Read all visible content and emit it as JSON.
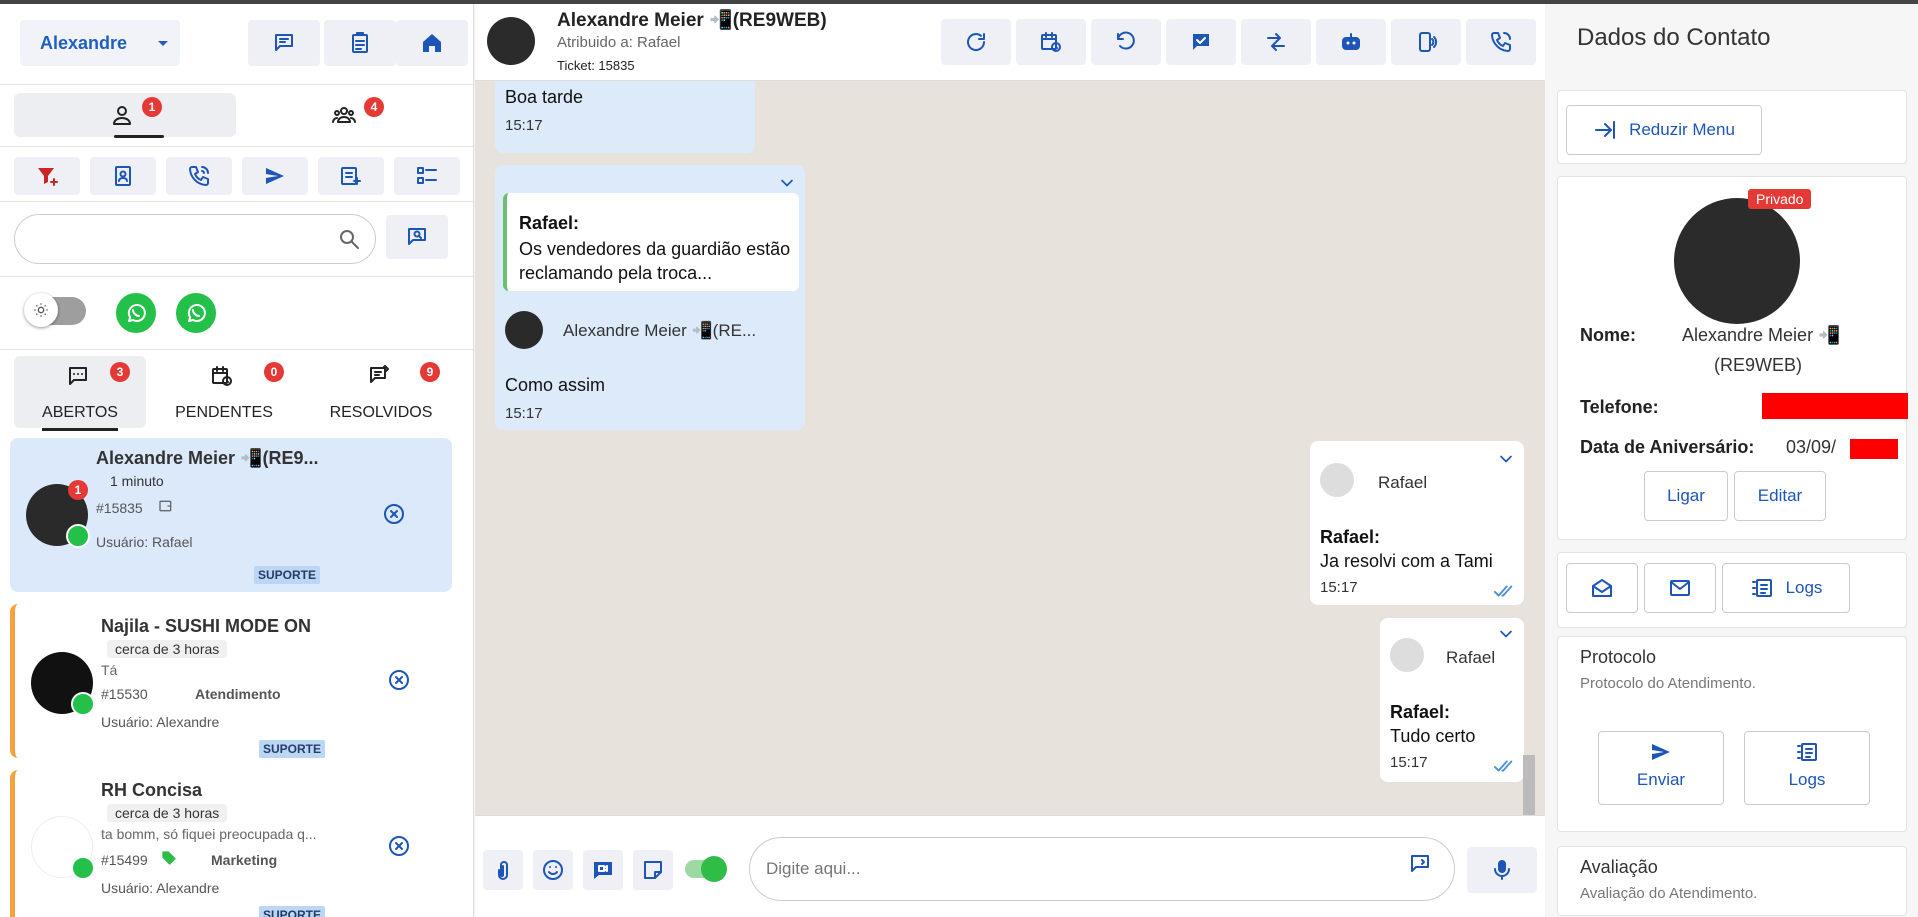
{
  "user_selector": {
    "label": "Alexandre"
  },
  "header_buttons": [
    "chat-icon",
    "clipboard-icon",
    "home-icon"
  ],
  "top_tabs": [
    {
      "icon": "person-icon",
      "badge": "1"
    },
    {
      "icon": "group-icon",
      "badge": "4"
    }
  ],
  "search": {
    "placeholder": ""
  },
  "status_tabs": [
    {
      "label": "ABERTOS",
      "badge": "3"
    },
    {
      "label": "PENDENTES",
      "badge": "0"
    },
    {
      "label": "RESOLVIDOS",
      "badge": "9"
    }
  ],
  "tickets": [
    {
      "name": "Alexandre Meier 📲(RE9...",
      "time": "1 minuto",
      "id": "#15835",
      "user": "Usuário: Rafael",
      "tag": "SUPORTE",
      "badge": "1"
    },
    {
      "name": "Najila - SUSHI MODE ON",
      "time": "cerca de 3 horas",
      "snippet": "Tá",
      "id": "#15530",
      "sector": "Atendimento",
      "user": "Usuário: Alexandre",
      "tag": "SUPORTE"
    },
    {
      "name": "RH Concisa",
      "time": "cerca de 3 horas",
      "snippet": "ta bomm, só fiquei preocupada q...",
      "id": "#15499",
      "sector": "Marketing",
      "user": "Usuário: Alexandre",
      "tag": "SUPORTE"
    }
  ],
  "chat": {
    "name": "Alexandre Meier 📲(RE9WEB)",
    "assigned": "Atribuido a: Rafael",
    "ticket": "Ticket: 15835",
    "messages": {
      "m1": {
        "text": "Boa tarde",
        "time": "15:17"
      },
      "m2": {
        "quote_author": "Rafael:",
        "quote_text": "Os vendedores da guardião estão reclamando pela troca...",
        "sender": "Alexandre Meier 📲(RE...",
        "text": "Como assim",
        "time": "15:17"
      },
      "m3": {
        "sender": "Rafael",
        "author": "Rafael:",
        "text": "Ja resolvi com a Tami",
        "time": "15:17"
      },
      "m4": {
        "sender": "Rafael",
        "author": "Rafael:",
        "text": "Tudo certo",
        "time": "15:17"
      }
    },
    "composer_placeholder": "Digite aqui..."
  },
  "contact": {
    "title": "Dados do Contato",
    "collapse_label": "Reduzir Menu",
    "private_badge": "Privado",
    "name_label": "Nome:",
    "name_value": "Alexandre Meier 📲",
    "name_value2": "(RE9WEB)",
    "phone_label": "Telefone:",
    "birthday_label": "Data de Aniversário:",
    "birthday_value": "03/09/",
    "call_label": "Ligar",
    "edit_label": "Editar",
    "logs_label": "Logs",
    "protocol_title": "Protocolo",
    "protocol_sub": "Protocolo do Atendimento.",
    "send_label": "Enviar",
    "protocol_logs_label": "Logs",
    "rating_title": "Avaliação",
    "rating_sub": "Avaliação do Atendimento."
  },
  "colors": {
    "accent": "#1d56b7",
    "whatsapp": "#23c04a",
    "badge": "#e53935",
    "selected_ticket": "#dbe9fb",
    "chat_bg": "#e8e2dc"
  }
}
